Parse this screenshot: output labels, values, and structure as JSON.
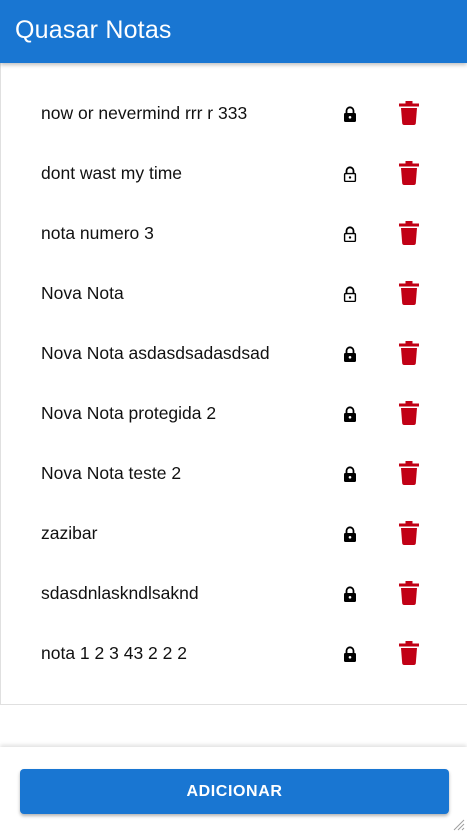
{
  "header": {
    "title": "Quasar Notas"
  },
  "colors": {
    "primary": "#1976d2",
    "delete": "#c10015",
    "lock": "#000000"
  },
  "notes": [
    {
      "title": "now or nevermind rrr r 333",
      "locked": true
    },
    {
      "title": "dont wast my time",
      "locked": false
    },
    {
      "title": "nota numero 3",
      "locked": false
    },
    {
      "title": "Nova Nota",
      "locked": false
    },
    {
      "title": "Nova Nota asdasdsadasdsad",
      "locked": true
    },
    {
      "title": "Nova Nota protegida 2",
      "locked": true
    },
    {
      "title": "Nova Nota teste 2",
      "locked": true
    },
    {
      "title": "zazibar",
      "locked": true
    },
    {
      "title": "sdasdnlaskndlsaknd",
      "locked": true
    },
    {
      "title": "nota 1 2 3 43 2 2 2",
      "locked": true
    }
  ],
  "icons": {
    "locked": "lock-icon",
    "unlocked": "lock-open-icon",
    "delete": "trash-icon"
  },
  "footer": {
    "add_label": "ADICIONAR"
  }
}
